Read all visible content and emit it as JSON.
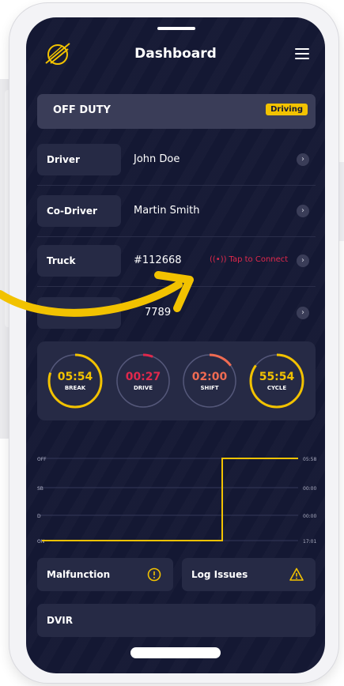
{
  "app": {
    "title": "Dashboard",
    "menu_icon": "hamburger-menu-icon",
    "logo_icon": "planet-logo-icon"
  },
  "status": {
    "label": "OFF DUTY",
    "badge": "Driving",
    "badge_color": "#f2c200"
  },
  "rows": [
    {
      "label": "Driver",
      "value": "John Doe"
    },
    {
      "label": "Co-Driver",
      "value": "Martin Smith"
    },
    {
      "label": "Truck",
      "value": "#112668",
      "connect_text": "Tap to Connect",
      "connect_color": "#e0284c"
    },
    {
      "label": "",
      "value": "7789"
    }
  ],
  "timers": [
    {
      "value": "05:54",
      "label": "BREAK",
      "color": "#f2c200",
      "progress": 0.8
    },
    {
      "value": "00:27",
      "label": "DRIVE",
      "color": "#e0284c",
      "progress": 0.06
    },
    {
      "value": "02:00",
      "label": "SHIFT",
      "color": "#ef6b52",
      "progress": 0.15
    },
    {
      "value": "55:54",
      "label": "CYCLE",
      "color": "#f2c200",
      "progress": 0.85
    }
  ],
  "log": {
    "rows": [
      "OFF",
      "SB",
      "D",
      "ON"
    ],
    "totals": [
      "05:58",
      "00:00",
      "00:00",
      "17:01"
    ],
    "line_color": "#f2c200"
  },
  "buttons": {
    "malfunction": "Malfunction",
    "log_issues": "Log Issues",
    "dvir": "DVIR"
  },
  "accent": "#f2c200"
}
